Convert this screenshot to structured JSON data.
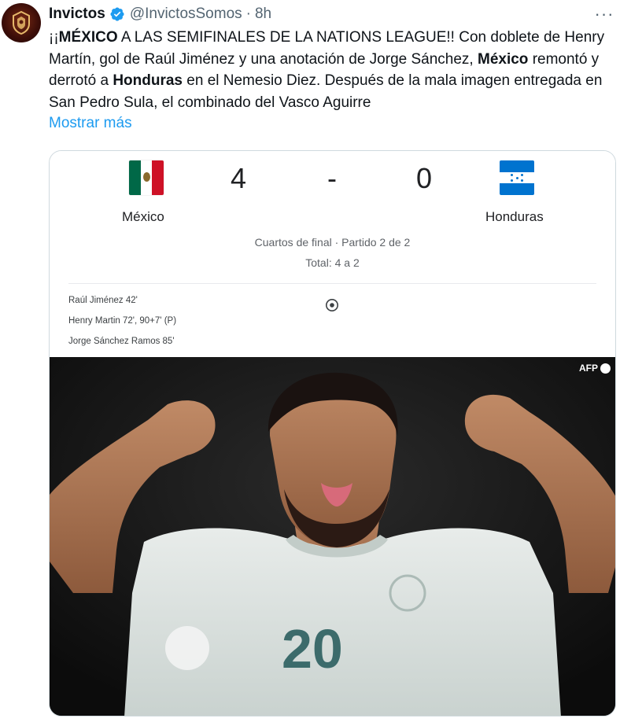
{
  "tweet": {
    "author_name": "Invictos",
    "handle": "@InvictosSomos",
    "separator": "·",
    "time": "8h",
    "more_label": "···",
    "text": {
      "p1": "¡¡",
      "b1": "MÉXICO",
      "p2": " A LAS SEMIFINALES DE LA NATIONS LEAGUE!! Con doblete de Henry Martín, gol de Raúl Jiménez y una anotación de Jorge Sánchez, ",
      "b2": "México",
      "p3": " remontó y derrotó a ",
      "b3": "Honduras",
      "p4": " en el Nemesio Diez. Después de la mala imagen entregada en San Pedro Sula, el combinado del Vasco Aguirre"
    },
    "show_more": "Mostrar más"
  },
  "match": {
    "home_team": "México",
    "away_team": "Honduras",
    "home_score": "4",
    "away_score": "0",
    "score_separator": "-",
    "stage": "Cuartos de final · Partido 2 de 2",
    "aggregate": "Total: 4 a 2",
    "scorers": [
      "Raúl Jiménez 42'",
      "Henry Martin 72', 90+7' (P)",
      "Jorge Sánchez Ramos 85'"
    ]
  },
  "photo": {
    "credit": "AFP",
    "jersey_number": "20"
  },
  "icons": {
    "verified": "verified-badge-icon",
    "more": "more-options-icon",
    "ball": "soccer-ball-icon"
  },
  "colors": {
    "link": "#1d9bf0",
    "verified": "#1d9bf0",
    "mexico_green": "#006847",
    "mexico_red": "#ce1126",
    "honduras_blue": "#0073cf"
  }
}
